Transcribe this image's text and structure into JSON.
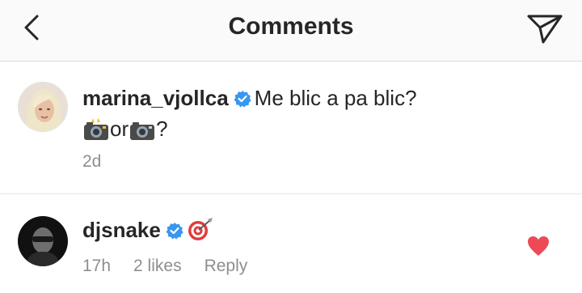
{
  "header": {
    "title": "Comments",
    "back_icon": "chevron-left-icon",
    "send_icon": "paper-plane-icon"
  },
  "comments": [
    {
      "username": "marina_vjollca",
      "verified": true,
      "text": "Me blic a pa blic?",
      "second_line_parts": [
        "camera-flash-emoji",
        "or",
        "camera-emoji",
        "?"
      ],
      "or_text": "or",
      "end_text": "?",
      "time": "2d"
    },
    {
      "username": "djsnake",
      "verified": true,
      "text_emoji": "direct-hit-emoji",
      "time": "17h",
      "likes": "2 likes",
      "reply": "Reply",
      "liked": true
    }
  ],
  "colors": {
    "verified_badge": "#3897f0",
    "heart": "#ed4956",
    "secondary_text": "#8e8e8e"
  }
}
